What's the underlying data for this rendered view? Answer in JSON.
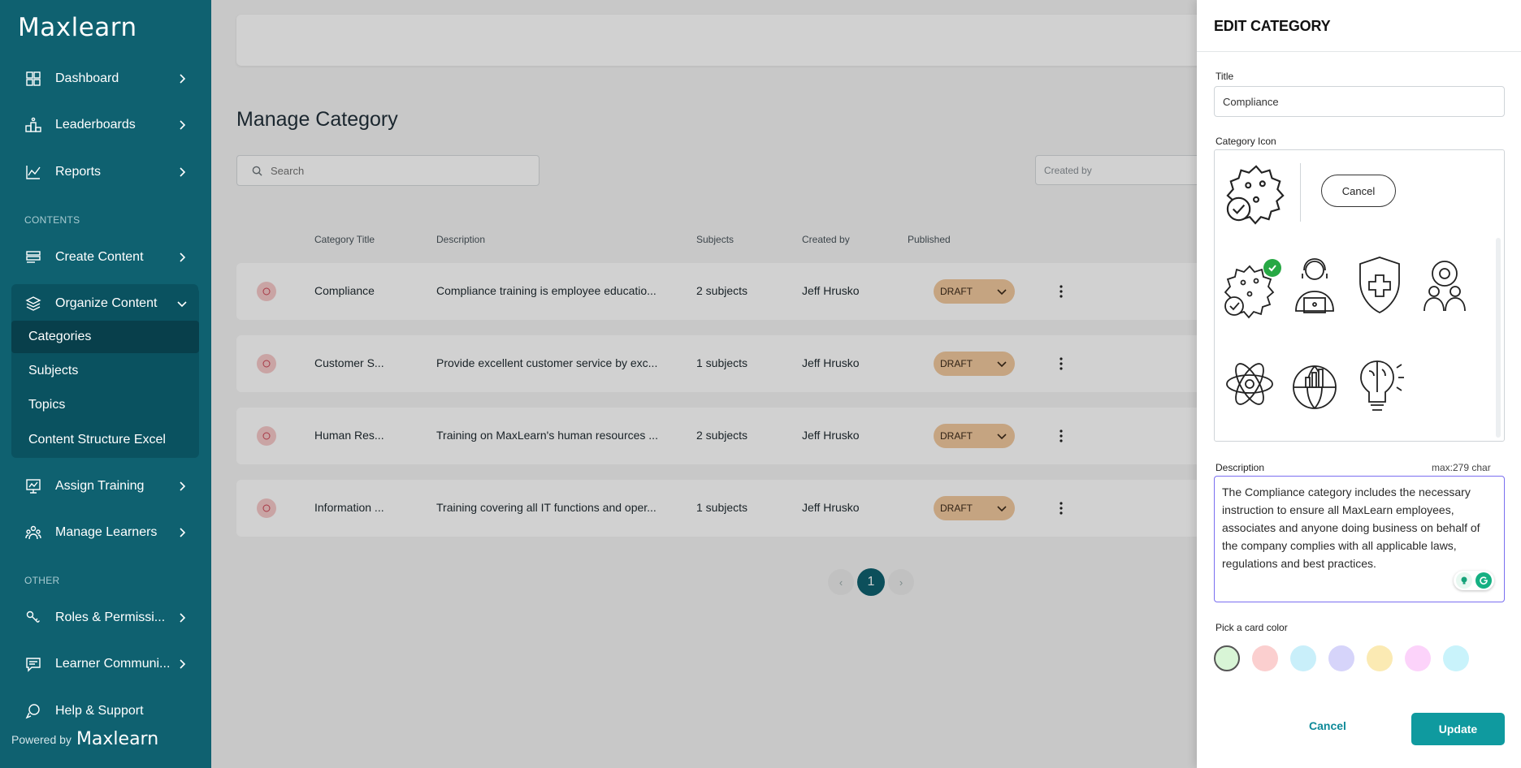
{
  "brand": {
    "name": "Maxlearn",
    "powered_by": "Powered by"
  },
  "sidebar": {
    "items": [
      {
        "label": "Dashboard",
        "icon": "dashboard-grid-icon"
      },
      {
        "label": "Leaderboards",
        "icon": "podium-icon"
      },
      {
        "label": "Reports",
        "icon": "line-chart-icon"
      },
      {
        "label": "Create Content",
        "icon": "create-content-icon"
      },
      {
        "label": "Organize Content",
        "icon": "layers-icon"
      },
      {
        "label": "Assign Training",
        "icon": "presentation-board-icon"
      },
      {
        "label": "Manage Learners",
        "icon": "people-group-icon"
      },
      {
        "label": "Roles & Permissi...",
        "icon": "key-hand-icon"
      },
      {
        "label": "Learner Communi...",
        "icon": "chat-icon"
      },
      {
        "label": "Help & Support",
        "icon": "help-chat-icon"
      }
    ],
    "section_contents": "CONTENTS",
    "section_other": "OTHER",
    "organize_sub": [
      "Categories",
      "Subjects",
      "Topics",
      "Content Structure Excel"
    ]
  },
  "main": {
    "title": "Manage Category",
    "search_placeholder": "Search",
    "created_by_placeholder": "Created by",
    "columns": [
      "Category Title",
      "Description",
      "Subjects",
      "Created by",
      "Published"
    ],
    "rows": [
      {
        "title": "Compliance",
        "description": "Compliance training is employee educatio...",
        "subjects": "2 subjects",
        "created_by": "Jeff Hrusko",
        "status": "DRAFT"
      },
      {
        "title": "Customer S...",
        "description": "Provide excellent customer service by exc...",
        "subjects": "1 subjects",
        "created_by": "Jeff Hrusko",
        "status": "DRAFT"
      },
      {
        "title": "Human Res...",
        "description": "Training on MaxLearn's human resources ...",
        "subjects": "2 subjects",
        "created_by": "Jeff Hrusko",
        "status": "DRAFT"
      },
      {
        "title": "Information ...",
        "description": "Training covering all IT functions and oper...",
        "subjects": "1 subjects",
        "created_by": "Jeff Hrusko",
        "status": "DRAFT"
      }
    ],
    "pagination": {
      "current": "1",
      "prev": "‹",
      "next": "›"
    }
  },
  "drawer": {
    "heading": "EDIT CATEGORY",
    "title_label": "Title",
    "title_value": "Compliance",
    "icon_label": "Category Icon",
    "icon_cancel": "Cancel",
    "icon_options": [
      "compliance-badge-icon",
      "support-agent-icon",
      "medical-shield-icon",
      "team-gear-icon",
      "atom-icon",
      "global-growth-icon",
      "brain-idea-icon"
    ],
    "description_label": "Description",
    "description_max": "max:279 char",
    "description_value": "The Compliance category includes the necessary instruction to ensure all MaxLearn employees, associates and anyone doing business on behalf of the company complies with all applicable laws, regulations and best practices.",
    "color_label": "Pick a card color",
    "colors": [
      "#d8f5d6",
      "#fbcfcf",
      "#c9effa",
      "#d6d4fa",
      "#fbeab3",
      "#fcd3fa",
      "#c9f3fb"
    ],
    "cancel_label": "Cancel",
    "update_label": "Update"
  }
}
